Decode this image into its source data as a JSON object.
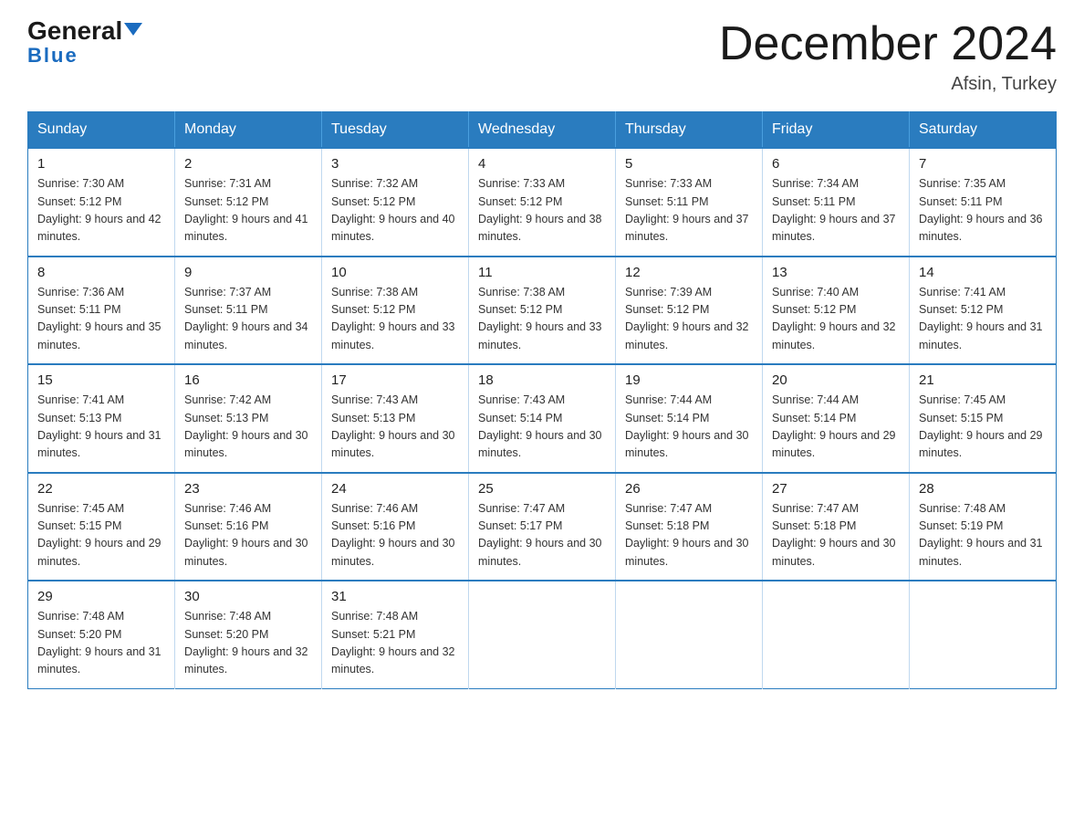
{
  "logo": {
    "general": "General",
    "blue": "Blue"
  },
  "header": {
    "title": "December 2024",
    "subtitle": "Afsin, Turkey"
  },
  "days_of_week": [
    "Sunday",
    "Monday",
    "Tuesday",
    "Wednesday",
    "Thursday",
    "Friday",
    "Saturday"
  ],
  "weeks": [
    [
      {
        "day": "1",
        "sunrise": "7:30 AM",
        "sunset": "5:12 PM",
        "daylight": "9 hours and 42 minutes."
      },
      {
        "day": "2",
        "sunrise": "7:31 AM",
        "sunset": "5:12 PM",
        "daylight": "9 hours and 41 minutes."
      },
      {
        "day": "3",
        "sunrise": "7:32 AM",
        "sunset": "5:12 PM",
        "daylight": "9 hours and 40 minutes."
      },
      {
        "day": "4",
        "sunrise": "7:33 AM",
        "sunset": "5:12 PM",
        "daylight": "9 hours and 38 minutes."
      },
      {
        "day": "5",
        "sunrise": "7:33 AM",
        "sunset": "5:11 PM",
        "daylight": "9 hours and 37 minutes."
      },
      {
        "day": "6",
        "sunrise": "7:34 AM",
        "sunset": "5:11 PM",
        "daylight": "9 hours and 37 minutes."
      },
      {
        "day": "7",
        "sunrise": "7:35 AM",
        "sunset": "5:11 PM",
        "daylight": "9 hours and 36 minutes."
      }
    ],
    [
      {
        "day": "8",
        "sunrise": "7:36 AM",
        "sunset": "5:11 PM",
        "daylight": "9 hours and 35 minutes."
      },
      {
        "day": "9",
        "sunrise": "7:37 AM",
        "sunset": "5:11 PM",
        "daylight": "9 hours and 34 minutes."
      },
      {
        "day": "10",
        "sunrise": "7:38 AM",
        "sunset": "5:12 PM",
        "daylight": "9 hours and 33 minutes."
      },
      {
        "day": "11",
        "sunrise": "7:38 AM",
        "sunset": "5:12 PM",
        "daylight": "9 hours and 33 minutes."
      },
      {
        "day": "12",
        "sunrise": "7:39 AM",
        "sunset": "5:12 PM",
        "daylight": "9 hours and 32 minutes."
      },
      {
        "day": "13",
        "sunrise": "7:40 AM",
        "sunset": "5:12 PM",
        "daylight": "9 hours and 32 minutes."
      },
      {
        "day": "14",
        "sunrise": "7:41 AM",
        "sunset": "5:12 PM",
        "daylight": "9 hours and 31 minutes."
      }
    ],
    [
      {
        "day": "15",
        "sunrise": "7:41 AM",
        "sunset": "5:13 PM",
        "daylight": "9 hours and 31 minutes."
      },
      {
        "day": "16",
        "sunrise": "7:42 AM",
        "sunset": "5:13 PM",
        "daylight": "9 hours and 30 minutes."
      },
      {
        "day": "17",
        "sunrise": "7:43 AM",
        "sunset": "5:13 PM",
        "daylight": "9 hours and 30 minutes."
      },
      {
        "day": "18",
        "sunrise": "7:43 AM",
        "sunset": "5:14 PM",
        "daylight": "9 hours and 30 minutes."
      },
      {
        "day": "19",
        "sunrise": "7:44 AM",
        "sunset": "5:14 PM",
        "daylight": "9 hours and 30 minutes."
      },
      {
        "day": "20",
        "sunrise": "7:44 AM",
        "sunset": "5:14 PM",
        "daylight": "9 hours and 29 minutes."
      },
      {
        "day": "21",
        "sunrise": "7:45 AM",
        "sunset": "5:15 PM",
        "daylight": "9 hours and 29 minutes."
      }
    ],
    [
      {
        "day": "22",
        "sunrise": "7:45 AM",
        "sunset": "5:15 PM",
        "daylight": "9 hours and 29 minutes."
      },
      {
        "day": "23",
        "sunrise": "7:46 AM",
        "sunset": "5:16 PM",
        "daylight": "9 hours and 30 minutes."
      },
      {
        "day": "24",
        "sunrise": "7:46 AM",
        "sunset": "5:16 PM",
        "daylight": "9 hours and 30 minutes."
      },
      {
        "day": "25",
        "sunrise": "7:47 AM",
        "sunset": "5:17 PM",
        "daylight": "9 hours and 30 minutes."
      },
      {
        "day": "26",
        "sunrise": "7:47 AM",
        "sunset": "5:18 PM",
        "daylight": "9 hours and 30 minutes."
      },
      {
        "day": "27",
        "sunrise": "7:47 AM",
        "sunset": "5:18 PM",
        "daylight": "9 hours and 30 minutes."
      },
      {
        "day": "28",
        "sunrise": "7:48 AM",
        "sunset": "5:19 PM",
        "daylight": "9 hours and 31 minutes."
      }
    ],
    [
      {
        "day": "29",
        "sunrise": "7:48 AM",
        "sunset": "5:20 PM",
        "daylight": "9 hours and 31 minutes."
      },
      {
        "day": "30",
        "sunrise": "7:48 AM",
        "sunset": "5:20 PM",
        "daylight": "9 hours and 32 minutes."
      },
      {
        "day": "31",
        "sunrise": "7:48 AM",
        "sunset": "5:21 PM",
        "daylight": "9 hours and 32 minutes."
      },
      null,
      null,
      null,
      null
    ]
  ]
}
